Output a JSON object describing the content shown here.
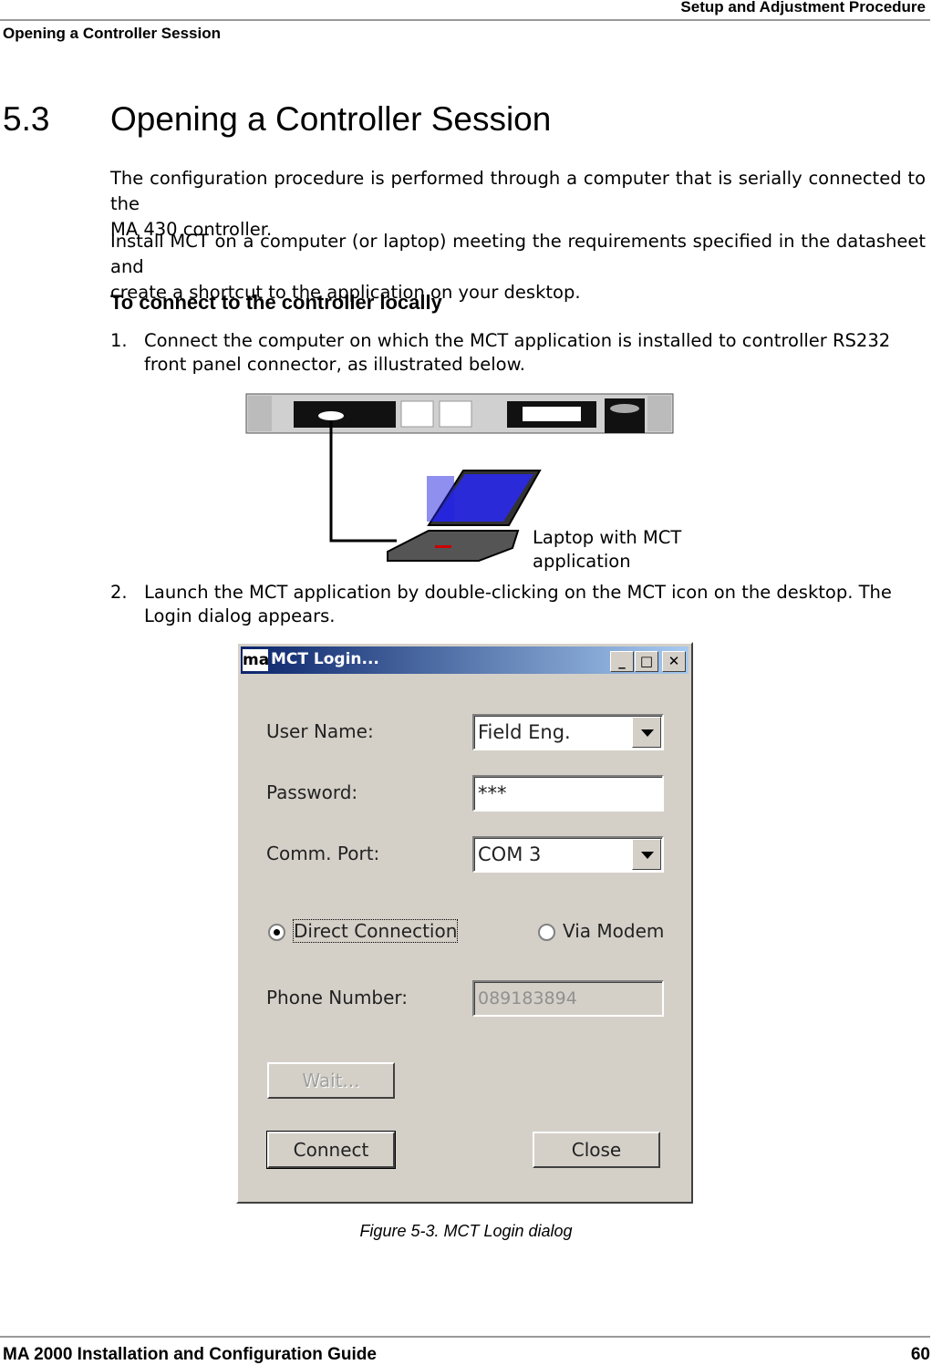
{
  "header": {
    "right": "Setup and Adjustment Procedure",
    "left": "Opening a Controller Session"
  },
  "section": {
    "number": "5.3",
    "title": "Opening a Controller Session"
  },
  "paragraphs": [
    [
      "The configuration procedure is performed through a computer that is serially connected to the",
      "MA 430 controller."
    ],
    [
      "Install MCT on a computer (or laptop) meeting the requirements specified in the datasheet and",
      "create a shortcut to the application on your desktop."
    ]
  ],
  "subheading": "To connect to the controller locally",
  "steps": [
    {
      "num": "1.",
      "text": "Connect the computer on which the MCT application is installed to controller RS232 front panel connector, as illustrated below."
    },
    {
      "num": "2.",
      "text": "Launch the MCT application by double-clicking on the MCT icon on the desktop. The Login dialog appears."
    }
  ],
  "figure1": {
    "label_line1": "Laptop with MCT",
    "label_line2": "application"
  },
  "dialog": {
    "icon_text": "ma",
    "title": "MCT Login...",
    "user_name_label": "User Name:",
    "user_name_value": "Field Eng.",
    "password_label": "Password:",
    "password_value": "***",
    "comm_port_label": "Comm. Port:",
    "comm_port_value": "COM 3",
    "direct_label": "Direct Connection",
    "modem_label": "Via Modem",
    "selected_connection": "Direct Connection",
    "phone_label": "Phone Number:",
    "phone_value": "089183894",
    "wait_label": "Wait...",
    "connect_label": "Connect",
    "close_label": "Close"
  },
  "caption": "Figure 5-3. MCT Login dialog",
  "footer": {
    "left": "MA 2000 Installation and Configuration Guide",
    "page": "60"
  }
}
